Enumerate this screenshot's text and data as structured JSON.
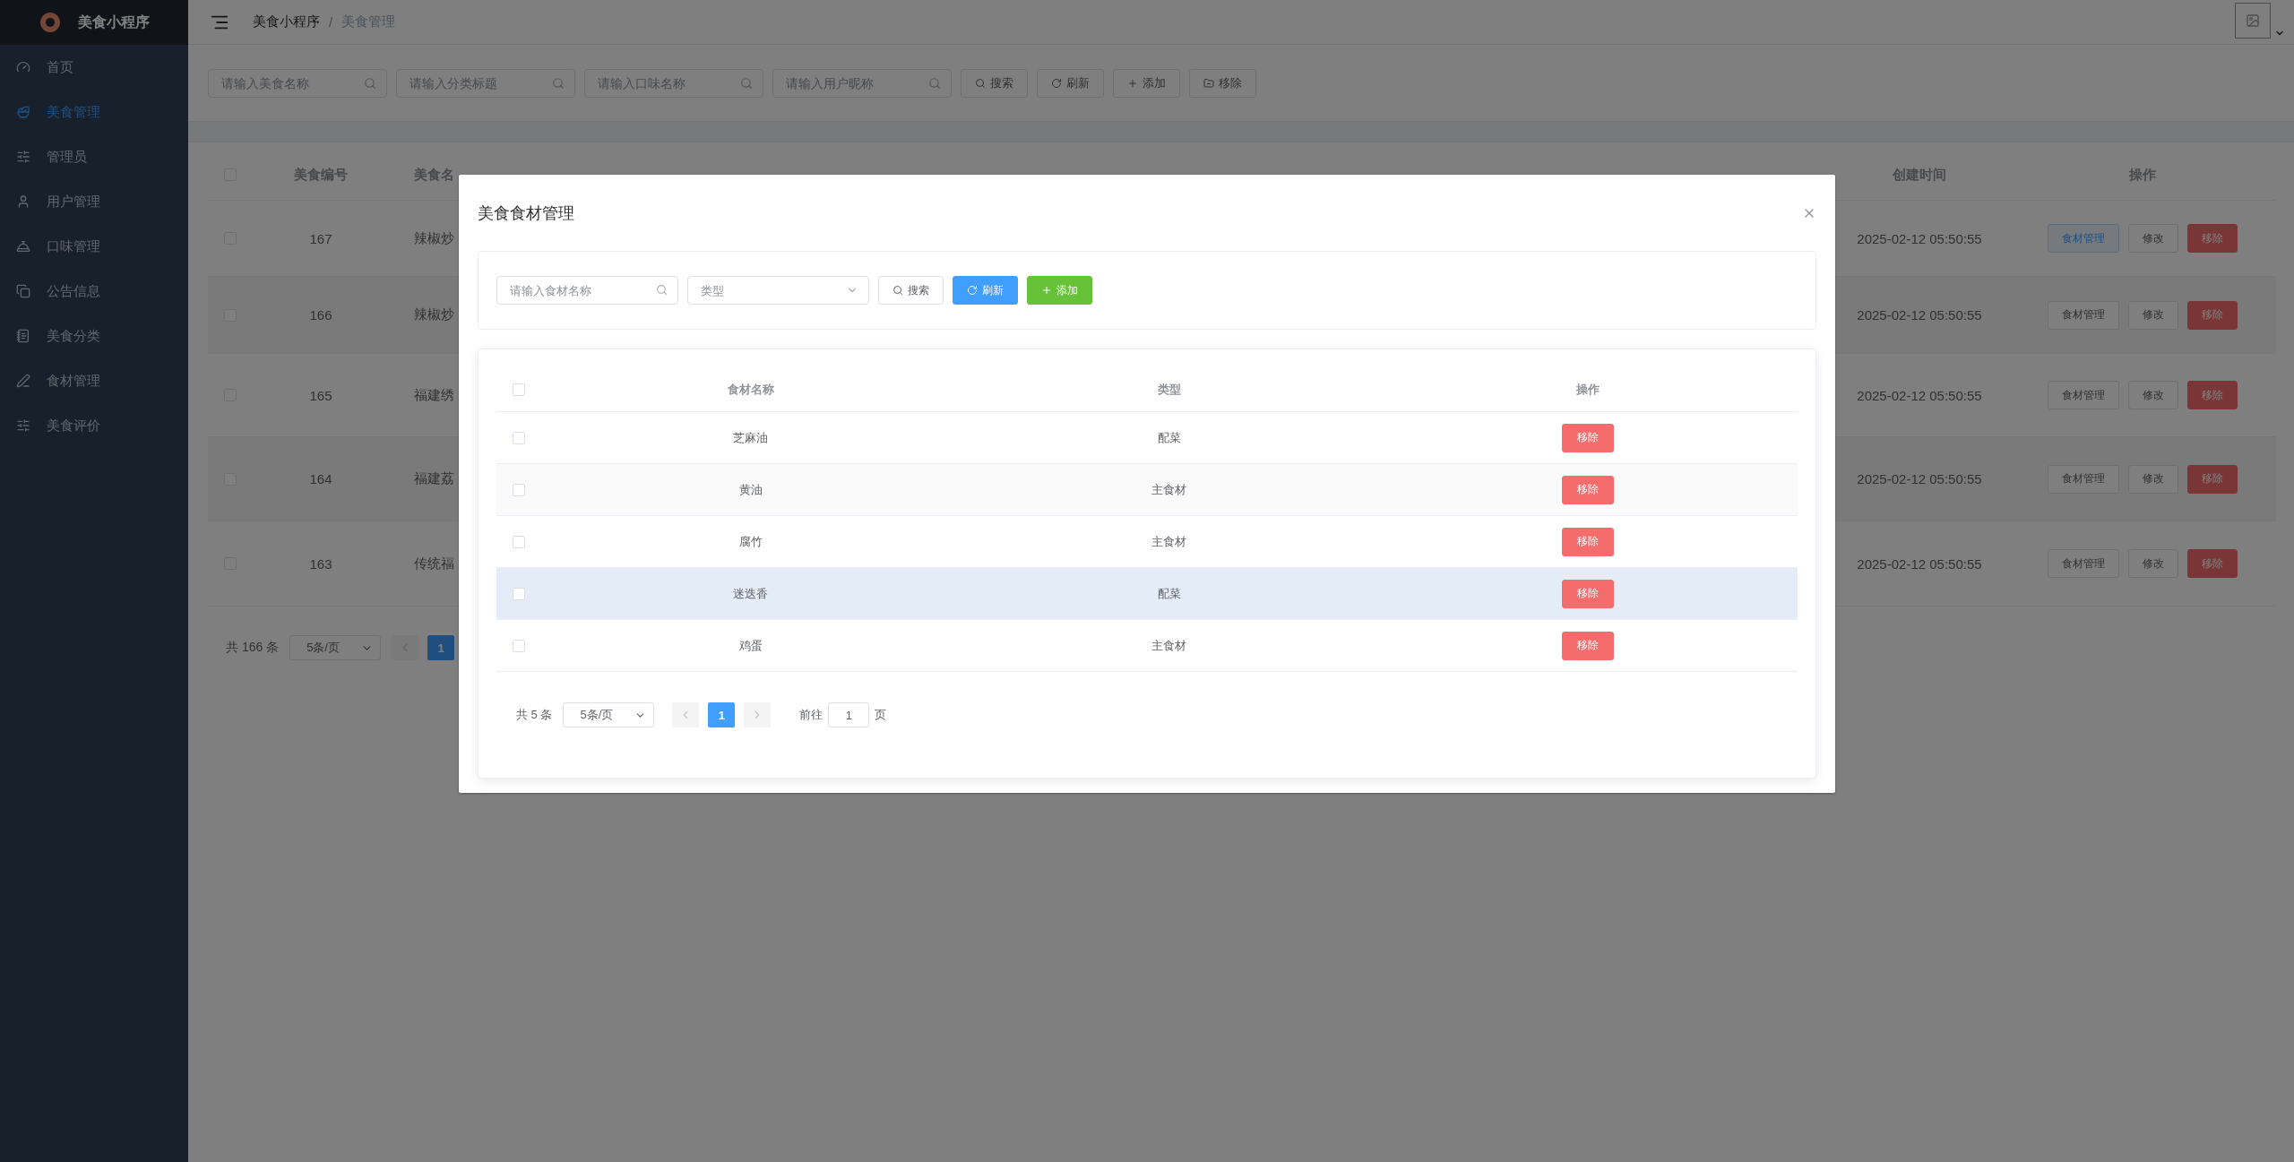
{
  "sidebar": {
    "title": "美食小程序",
    "items": [
      {
        "label": "首页",
        "selected": false
      },
      {
        "label": "美食管理",
        "selected": true
      },
      {
        "label": "管理员",
        "selected": false
      },
      {
        "label": "用户管理",
        "selected": false
      },
      {
        "label": "口味管理",
        "selected": false
      },
      {
        "label": "公告信息",
        "selected": false
      },
      {
        "label": "美食分类",
        "selected": false
      },
      {
        "label": "食材管理",
        "selected": false
      },
      {
        "label": "美食评价",
        "selected": false
      }
    ]
  },
  "header": {
    "breadcrumb": [
      "美食小程序",
      "美食管理"
    ],
    "separator": "/"
  },
  "filters": {
    "inputs": [
      {
        "placeholder": "请输入美食名称"
      },
      {
        "placeholder": "请输入分类标题"
      },
      {
        "placeholder": "请输入口味名称"
      },
      {
        "placeholder": "请输入用户昵称"
      }
    ],
    "buttons": [
      {
        "label": "搜索",
        "kind": "search"
      },
      {
        "label": "刷新",
        "kind": "refresh"
      },
      {
        "label": "添加",
        "kind": "add"
      },
      {
        "label": "移除",
        "kind": "remove"
      }
    ]
  },
  "table": {
    "select_all": {
      "checked": false
    },
    "columns": [
      "美食编号",
      "美食名",
      "创建时间",
      "操作"
    ],
    "rows": [
      {
        "checked": false,
        "id": "167",
        "name": "辣椒炒",
        "created": "2025-02-12 05:50:55",
        "manage": {
          "label": "食材管理",
          "focused": true
        },
        "edit": "修改",
        "remove": "移除"
      },
      {
        "checked": false,
        "id": "166",
        "name": "辣椒炒",
        "created": "2025-02-12 05:50:55",
        "manage": {
          "label": "食材管理",
          "focused": false
        },
        "edit": "修改",
        "remove": "移除"
      },
      {
        "checked": false,
        "id": "165",
        "name": "福建绣",
        "created": "2025-02-12 05:50:55",
        "manage": {
          "label": "食材管理",
          "focused": false
        },
        "edit": "修改",
        "remove": "移除"
      },
      {
        "checked": false,
        "id": "164",
        "name": "福建荔",
        "created": "2025-02-12 05:50:55",
        "manage": {
          "label": "食材管理",
          "focused": false
        },
        "edit": "修改",
        "remove": "移除"
      },
      {
        "checked": false,
        "id": "163",
        "name": "传统福",
        "created": "2025-02-12 05:50:55",
        "manage": {
          "label": "食材管理",
          "focused": false
        },
        "edit": "修改",
        "remove": "移除"
      }
    ],
    "pagination": {
      "total": "共 166 条",
      "page_size": "5条/页",
      "pages": [
        {
          "label": "1",
          "selected": true
        }
      ]
    }
  },
  "dialog": {
    "title": "美食食材管理",
    "search": {
      "placeholder": "请输入食材名称"
    },
    "type_select": {
      "placeholder": "类型"
    },
    "buttons": [
      {
        "label": "搜索",
        "kind": "search"
      },
      {
        "label": "刷新",
        "kind": "refresh"
      },
      {
        "label": "添加",
        "kind": "add"
      }
    ],
    "table": {
      "select_all": {
        "checked": false
      },
      "columns": [
        "食材名称",
        "类型",
        "操作"
      ],
      "rows": [
        {
          "checked": false,
          "highlighted": false,
          "name": "芝麻油",
          "type": "配菜",
          "action": "移除"
        },
        {
          "checked": false,
          "highlighted": false,
          "name": "黄油",
          "type": "主食材",
          "action": "移除"
        },
        {
          "checked": false,
          "highlighted": false,
          "name": "腐竹",
          "type": "主食材",
          "action": "移除"
        },
        {
          "checked": false,
          "highlighted": true,
          "name": "迷迭香",
          "type": "配菜",
          "action": "移除"
        },
        {
          "checked": false,
          "highlighted": false,
          "name": "鸡蛋",
          "type": "主食材",
          "action": "移除"
        }
      ]
    },
    "pagination": {
      "total": "共 5 条",
      "page_size": "5条/页",
      "pages": [
        {
          "label": "1",
          "selected": true
        }
      ],
      "goto_label": "前往",
      "goto_value": "1",
      "goto_suffix": "页"
    }
  }
}
